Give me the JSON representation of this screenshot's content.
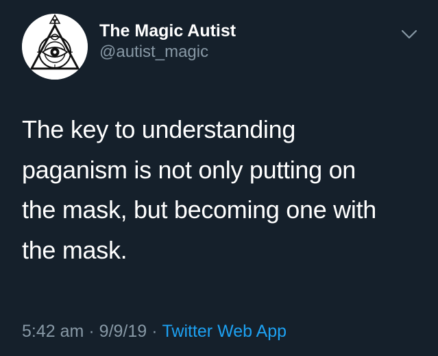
{
  "author": {
    "display_name": "The Magic Autist",
    "handle": "@autist_magic",
    "avatar_icon": "all-seeing-eye-triangle-icon"
  },
  "tweet": {
    "text": "The key to understanding\npaganism is not only putting on\nthe mask, but becoming one with\nthe mask."
  },
  "meta": {
    "time": "5:42 am",
    "separator": "·",
    "date": "9/9/19",
    "source": "Twitter Web App"
  },
  "icons": {
    "menu": "chevron-down-icon"
  },
  "colors": {
    "background": "#15202b",
    "primary_text": "#ffffff",
    "secondary_text": "#8899a6",
    "link": "#1da1f2"
  }
}
